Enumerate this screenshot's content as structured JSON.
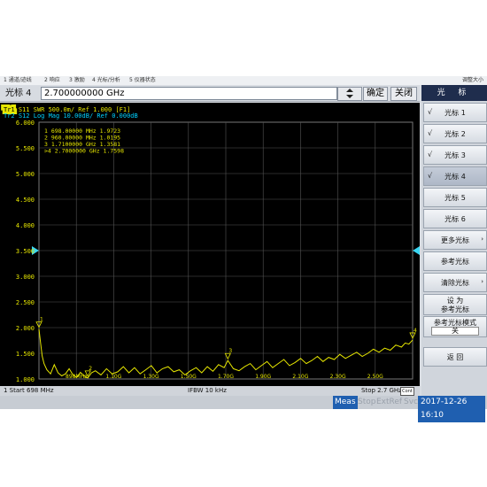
{
  "menubar": {
    "items": [
      "1 通道/迹线",
      "2 响应",
      "3 激励",
      "4 光标/分析",
      "5 仪器状态"
    ],
    "right": "调整大小"
  },
  "entry": {
    "label": "光标 4",
    "value": "2.700000000 GHz",
    "ok_label": "确定",
    "close_label": "关闭"
  },
  "traces": {
    "tr1": "Tr1",
    "tr1_text": " S11  SWR 500.0m/ Ref 1.000 [F1]",
    "tr2": "Tr2",
    "tr2_text": " S12  Log Mag 10.00dB/ Ref 0.000dB"
  },
  "markers": [
    {
      "num": "1",
      "freq": "698.00000 MHz",
      "value": "1.9723",
      "active": false
    },
    {
      "num": "2",
      "freq": "960.00000 MHz",
      "value": "1.0195",
      "active": false
    },
    {
      "num": "3",
      "freq": "1.7100000 GHz",
      "value": "1.3581",
      "active": false
    },
    {
      "num": ">4",
      "freq": "2.7000000 GHz",
      "value": "1.7598",
      "active": true
    }
  ],
  "chart_data": {
    "type": "line",
    "ylim": [
      1.0,
      6.0
    ],
    "xlim_ghz": [
      0.698,
      2.7
    ],
    "y_ticks": [
      "6.000",
      "5.500",
      "5.000",
      "4.500",
      "4.000",
      "3.500",
      "3.000",
      "2.500",
      "2.000",
      "1.500",
      "1.000"
    ],
    "x_ticks": [
      "898MHz",
      "1.10G",
      "1.30G",
      "1.50G",
      "1.70G",
      "1.90G",
      "2.10G",
      "2.30G",
      "2.50G"
    ],
    "ref_level": 3.5,
    "series": [
      {
        "x": [
          0.698,
          0.705,
          0.715,
          0.725,
          0.74,
          0.76,
          0.78,
          0.8,
          0.82,
          0.84,
          0.86,
          0.88,
          0.9,
          0.92,
          0.94,
          0.96,
          0.98,
          1.0,
          1.03,
          1.06,
          1.09,
          1.12,
          1.15,
          1.18,
          1.21,
          1.24,
          1.27,
          1.3,
          1.33,
          1.36,
          1.39,
          1.42,
          1.45,
          1.48,
          1.51,
          1.54,
          1.57,
          1.6,
          1.63,
          1.66,
          1.69,
          1.71,
          1.74,
          1.77,
          1.8,
          1.83,
          1.86,
          1.89,
          1.92,
          1.95,
          1.98,
          2.01,
          2.04,
          2.07,
          2.1,
          2.13,
          2.16,
          2.19,
          2.22,
          2.25,
          2.28,
          2.31,
          2.34,
          2.37,
          2.4,
          2.43,
          2.46,
          2.49,
          2.52,
          2.55,
          2.58,
          2.61,
          2.64,
          2.66,
          2.68,
          2.7
        ],
        "values": [
          1.97,
          1.75,
          1.45,
          1.3,
          1.18,
          1.1,
          1.28,
          1.12,
          1.06,
          1.1,
          1.2,
          1.08,
          1.03,
          1.13,
          1.06,
          1.02,
          1.12,
          1.16,
          1.08,
          1.2,
          1.1,
          1.14,
          1.24,
          1.12,
          1.22,
          1.1,
          1.18,
          1.26,
          1.12,
          1.2,
          1.24,
          1.14,
          1.18,
          1.08,
          1.16,
          1.22,
          1.12,
          1.24,
          1.15,
          1.28,
          1.22,
          1.36,
          1.2,
          1.16,
          1.24,
          1.3,
          1.18,
          1.26,
          1.34,
          1.22,
          1.3,
          1.38,
          1.26,
          1.32,
          1.4,
          1.3,
          1.36,
          1.44,
          1.34,
          1.42,
          1.38,
          1.48,
          1.4,
          1.46,
          1.52,
          1.44,
          1.5,
          1.58,
          1.52,
          1.6,
          1.56,
          1.66,
          1.62,
          1.7,
          1.68,
          1.76
        ]
      }
    ]
  },
  "status": {
    "start": "1  Start 698 MHz",
    "ifbw": "IFBW 10 kHz",
    "stop": "Stop 2.7 GHz",
    "cont": "Cont"
  },
  "bottombar": {
    "meas": "Meas",
    "stop": "Stop",
    "extref": "ExtRef",
    "svc": "Svc",
    "datetime": "2017-12-26 16:10"
  },
  "softkeys": {
    "title": "光 标",
    "marker1": "光标 1",
    "marker2": "光标 2",
    "marker3": "光标 3",
    "marker4": "光标 4",
    "marker5": "光标 5",
    "marker6": "光标 6",
    "more_markers": "更多光标",
    "ref_marker": "参考光标",
    "clear_marker": "清除光标",
    "set_as_1": "设  为",
    "set_as_2": "参考光标",
    "ref_mode": "参考光标模式",
    "ref_mode_value": "关",
    "back": "返  回",
    "check": "√"
  },
  "colors": {
    "trace": "#e6e600",
    "tr2": "#00d0ff",
    "grid": "#555555",
    "ref_arrow": "#3ad6f2",
    "softkey_title_bg": "#1f2d4d",
    "accent": "#1f5fb0"
  }
}
